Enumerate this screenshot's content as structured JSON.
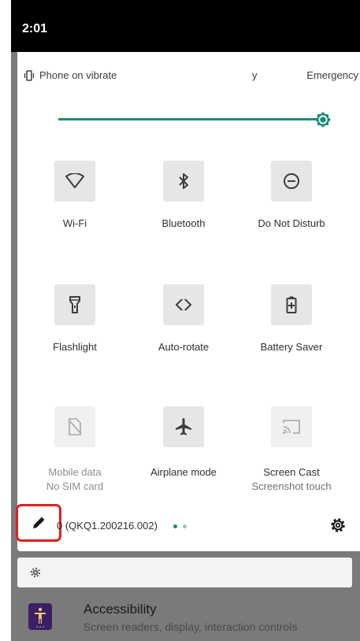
{
  "status_bar": {
    "time": "2:01"
  },
  "header": {
    "vibrate_text": "Phone on vibrate",
    "carrier_fragment": "y",
    "emergency_text": "Emergency"
  },
  "brightness": {
    "level": 1.0,
    "accent_color": "#1f8a7a"
  },
  "tiles": [
    {
      "label": "Wi-Fi",
      "icon": "wifi-icon"
    },
    {
      "label": "Bluetooth",
      "icon": "bluetooth-icon"
    },
    {
      "label": "Do Not Disturb",
      "icon": "dnd-icon"
    },
    {
      "label": "Flashlight",
      "icon": "flashlight-icon"
    },
    {
      "label": "Auto-rotate",
      "icon": "auto-rotate-icon"
    },
    {
      "label": "Battery Saver",
      "icon": "battery-saver-icon"
    },
    {
      "label": "Mobile data",
      "sublabel": "No SIM card",
      "icon": "mobile-data-icon"
    },
    {
      "label": "Airplane mode",
      "icon": "airplane-icon"
    },
    {
      "label": "Screen Cast",
      "sublabel": "Screenshot touch",
      "icon": "screen-cast-icon"
    }
  ],
  "footer": {
    "build_text": "0 (QKQ1.200216.002)",
    "highlight_color": "#e0201a"
  },
  "settings_item": {
    "title": "Accessibility",
    "subtitle": "Screen readers, display, interaction controls"
  }
}
